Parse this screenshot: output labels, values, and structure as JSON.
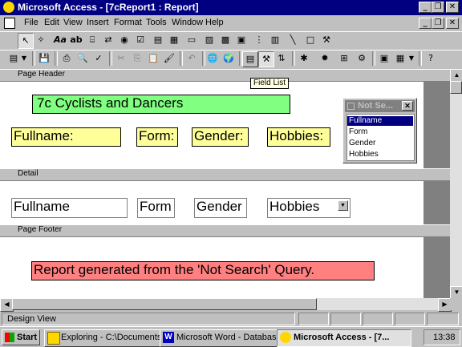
{
  "window": {
    "title": "Microsoft Access - [7cReport1 : Report]"
  },
  "menu": [
    "File",
    "Edit",
    "View",
    "Insert",
    "Format",
    "Tools",
    "Window",
    "Help"
  ],
  "toolbox": [
    "select",
    "wizard",
    "Aa",
    "ab|",
    "option-group",
    "toggle",
    "option",
    "check",
    "combo",
    "list",
    "command",
    "image",
    "unbound-frame",
    "bound-frame",
    "page-break",
    "subform",
    "line",
    "rectangle",
    "more"
  ],
  "tooltip": "Field List",
  "sections": {
    "page_header": "Page Header",
    "detail": "Detail",
    "page_footer": "Page Footer"
  },
  "page_header": {
    "title_label": "7c Cyclists and Dancers",
    "labels": [
      "Fullname:",
      "Form:",
      "Gender:",
      "Hobbies:"
    ]
  },
  "detail": {
    "fields": [
      "Fullname",
      "Form",
      "Gender",
      "Hobbies"
    ]
  },
  "page_footer": {
    "footer_label": "Report generated from the 'Not Search' Query."
  },
  "field_list": {
    "title": "Not Se...",
    "items": [
      "Fullname",
      "Form",
      "Gender",
      "Hobbies"
    ],
    "selected": "Fullname"
  },
  "status": {
    "text": "Design View"
  },
  "taskbar": {
    "start": "Start",
    "tasks": [
      "Exploring - C:\\Documents",
      "Microsoft Word - Database...",
      "Microsoft Access - [7..."
    ],
    "clock": "13:38"
  },
  "colors": {
    "title_bar": "#000080",
    "label_bg": "#ffff99",
    "title_label_bg": "#80ff80",
    "footer_bg": "#ff8080"
  }
}
